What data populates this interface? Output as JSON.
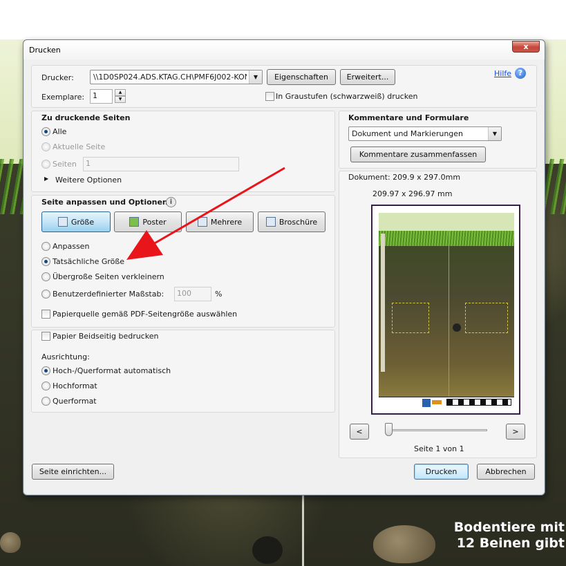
{
  "background": {
    "caption_line1": "Bodentiere mit",
    "caption_line2": "12 Beinen gibt"
  },
  "dialog": {
    "title": "Drucken",
    "close_label": "x",
    "printer": {
      "label": "Drucker:",
      "value": "\\\\1D0SP024.ADS.KTAG.CH\\PMF6J002-KON",
      "properties_label": "Eigenschaften",
      "advanced_label": "Erweitert..."
    },
    "help": {
      "label": "Hilfe",
      "icon": "help-icon"
    },
    "copies": {
      "label": "Exemplare:",
      "value": "1"
    },
    "grayscale": {
      "label": "In Graustufen (schwarzweiß) drucken",
      "checked": false
    },
    "pages": {
      "heading": "Zu druckende Seiten",
      "options": [
        "Alle",
        "Aktuelle Seite",
        "Seiten"
      ],
      "selected": "Alle",
      "range_value": "1",
      "more_options": "Weitere Optionen"
    },
    "fit": {
      "heading": "Seite anpassen und Optionen",
      "tabs": [
        "Größe",
        "Poster",
        "Mehrere",
        "Broschüre"
      ],
      "selected_tab": "Größe",
      "options": [
        "Anpassen",
        "Tatsächliche Größe",
        "Übergroße Seiten verkleinern",
        "Benutzerdefinierter Maßstab:"
      ],
      "selected": "Tatsächliche Größe",
      "scale_value": "100",
      "scale_unit": "%",
      "paper_source_label": "Papierquelle gemäß PDF-Seitengröße auswählen"
    },
    "duplex": {
      "label": "Papier Beidseitig bedrucken",
      "checked": false
    },
    "orientation": {
      "heading": "Ausrichtung:",
      "options": [
        "Hoch-/Querformat automatisch",
        "Hochformat",
        "Querformat"
      ],
      "selected": "Hoch-/Querformat automatisch"
    },
    "comments": {
      "heading": "Kommentare und Formulare",
      "value": "Dokument und Markierungen",
      "summarize_label": "Kommentare zusammenfassen"
    },
    "preview": {
      "document_size": "Dokument: 209.9 x 297.0mm",
      "page_size": "209.97 x 296.97 mm",
      "prev_label": "<",
      "next_label": ">",
      "page_indicator": "Seite 1 von 1"
    },
    "footer": {
      "page_setup_label": "Seite einrichten...",
      "print_label": "Drucken",
      "cancel_label": "Abbrechen"
    },
    "annotation_color": "#e8151b"
  }
}
